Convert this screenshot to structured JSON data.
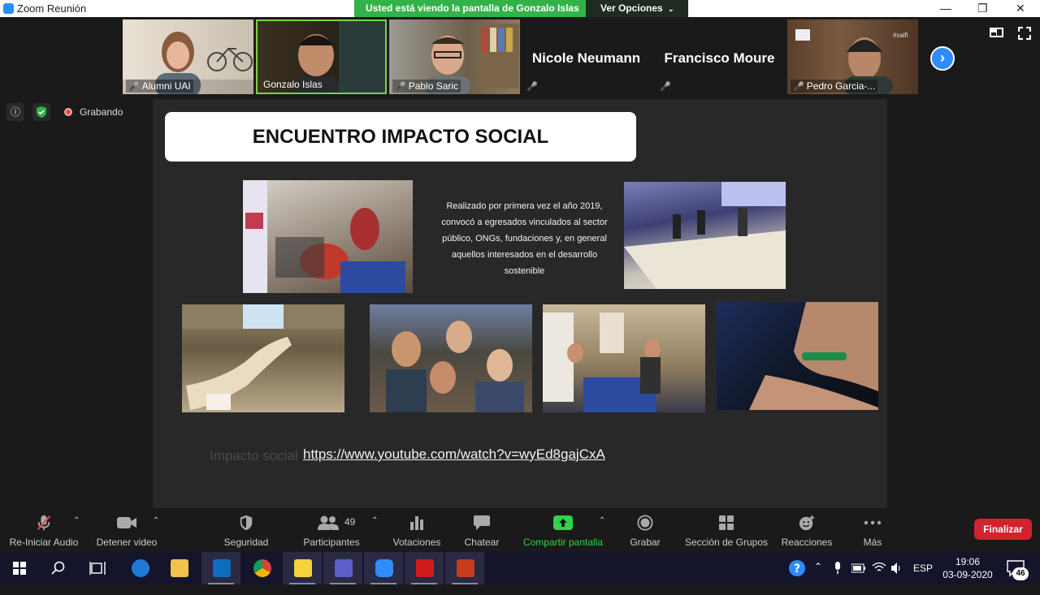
{
  "window": {
    "title": "Zoom Reunión",
    "share_banner": "Usted está viendo la pantalla de Gonzalo Islas",
    "view_options": "Ver Opciones"
  },
  "participants": [
    {
      "name": "Alumni UAI",
      "has_video": true,
      "muted": true
    },
    {
      "name": "Gonzalo Islas",
      "has_video": true,
      "muted": false,
      "speaking": true
    },
    {
      "name": "Pablo Saric",
      "has_video": true,
      "muted": true
    },
    {
      "name": "Nicole Neumann",
      "has_video": false,
      "muted": true
    },
    {
      "name": "Francisco Moure",
      "has_video": false,
      "muted": true
    },
    {
      "name": "Pedro Garcia-...",
      "has_video": true,
      "muted": true,
      "badge": "#salfi"
    }
  ],
  "status": {
    "recording_label": "Grabando"
  },
  "slide": {
    "title": "ENCUENTRO IMPACTO SOCIAL",
    "description": "Realizado por primera vez el año 2019, convocó a egresados vinculados al sector público, ONGs, fundaciones y, en general aquellos interesados en el desarrollo sostenible",
    "link_ghost": "Impacto social",
    "link_url": "https://www.youtube.com/watch?v=wyEd8gajCxA"
  },
  "toolbar": {
    "audio": "Re-Iniciar Audio",
    "video": "Detener video",
    "security": "Seguridad",
    "participants": "Participantes",
    "participants_count": "49",
    "polls": "Votaciones",
    "chat": "Chatear",
    "share": "Compartir pantalla",
    "record": "Grabar",
    "breakout": "Sección de Grupos",
    "reactions": "Reacciones",
    "more": "Más",
    "end": "Finalizar"
  },
  "taskbar": {
    "language": "ESP",
    "time": "19:06",
    "date": "03-09-2020",
    "notifications": "46"
  },
  "colors": {
    "zoom_blue": "#2d8cff",
    "share_green": "#33b249",
    "end_red": "#d1222d",
    "mute_red": "#e34848"
  }
}
